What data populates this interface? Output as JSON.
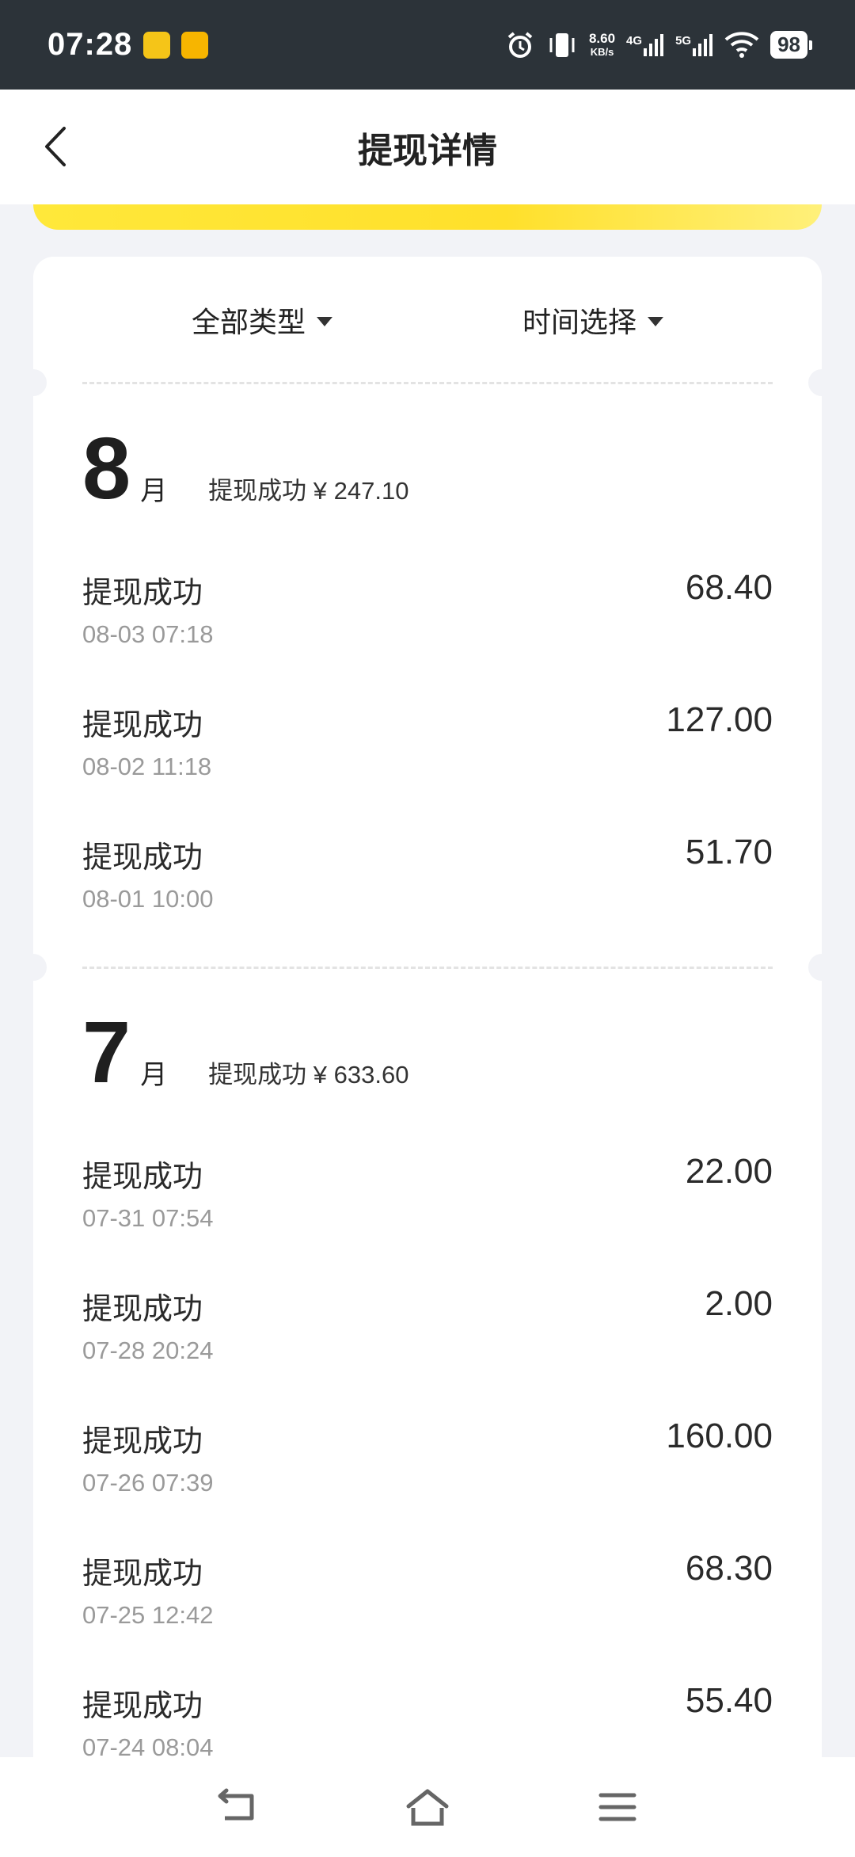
{
  "status": {
    "time": "07:28",
    "net_speed_value": "8.60",
    "net_speed_unit": "KB/s",
    "sig1": "4G",
    "sig2": "5G",
    "battery": "98"
  },
  "header": {
    "title": "提现详情"
  },
  "filters": {
    "type_label": "全部类型",
    "time_label": "时间选择"
  },
  "months": [
    {
      "month": "8",
      "unit": "月",
      "summary": "提现成功 ¥ 247.10",
      "items": [
        {
          "title": "提现成功",
          "time": "08-03 07:18",
          "amount": "68.40"
        },
        {
          "title": "提现成功",
          "time": "08-02 11:18",
          "amount": "127.00"
        },
        {
          "title": "提现成功",
          "time": "08-01 10:00",
          "amount": "51.70"
        }
      ]
    },
    {
      "month": "7",
      "unit": "月",
      "summary": "提现成功 ¥ 633.60",
      "items": [
        {
          "title": "提现成功",
          "time": "07-31 07:54",
          "amount": "22.00"
        },
        {
          "title": "提现成功",
          "time": "07-28 20:24",
          "amount": "2.00"
        },
        {
          "title": "提现成功",
          "time": "07-26 07:39",
          "amount": "160.00"
        },
        {
          "title": "提现成功",
          "time": "07-25 12:42",
          "amount": "68.30"
        },
        {
          "title": "提现成功",
          "time": "07-24 08:04",
          "amount": "55.40"
        }
      ]
    }
  ]
}
